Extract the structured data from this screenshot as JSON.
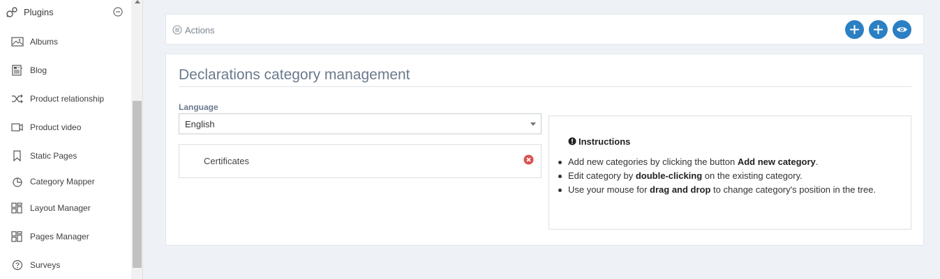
{
  "sidebar": {
    "header": {
      "label": "Plugins",
      "icon": "plugins-icon",
      "collapse_icon": "minus-circle-icon"
    },
    "items": [
      {
        "label": "Albums",
        "icon": "image-icon"
      },
      {
        "label": "Blog",
        "icon": "blog-icon"
      },
      {
        "label": "Product relationship",
        "icon": "shuffle-icon"
      },
      {
        "label": "Product video",
        "icon": "video-icon"
      },
      {
        "label": "Static Pages",
        "icon": "bookmark-icon"
      },
      {
        "label": "Category Mapper",
        "icon": "pie-chart-icon"
      },
      {
        "label": "Layout Manager",
        "icon": "layout-icon"
      },
      {
        "label": "Pages Manager",
        "icon": "layout-icon"
      },
      {
        "label": "Surveys",
        "icon": "question-circle-icon"
      }
    ]
  },
  "actions": {
    "label": "Actions",
    "icon": "list-circle-icon",
    "buttons": [
      {
        "icon": "plus-icon"
      },
      {
        "icon": "plus-icon"
      },
      {
        "icon": "eye-icon"
      }
    ],
    "button_color": "#2b7fc3"
  },
  "main": {
    "title": "Declarations category management",
    "language": {
      "label": "Language",
      "selected": "English"
    },
    "tree": {
      "items": [
        {
          "label": "Certificates"
        }
      ]
    },
    "instructions": {
      "title": "Instructions",
      "items": [
        {
          "pre": "Add new categories by clicking the button ",
          "bold": "Add new category",
          "post": "."
        },
        {
          "pre": "Edit category by ",
          "bold": "double-clicking",
          "post": " on the existing category."
        },
        {
          "pre": "Use your mouse for ",
          "bold": "drag and drop",
          "post": " to change category's position in the tree."
        }
      ]
    }
  }
}
